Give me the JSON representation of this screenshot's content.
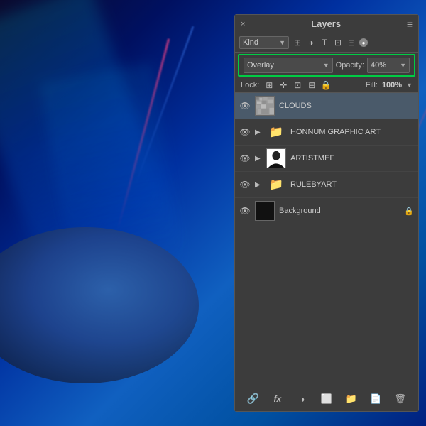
{
  "background": {
    "description": "Space scene with planet and light streaks"
  },
  "panel": {
    "title": "Layers",
    "close_label": "×",
    "menu_icon": "≡",
    "toolbar": {
      "kind_label": "Kind",
      "icons": [
        "checkerboard",
        "circle-half",
        "T",
        "transform",
        "artboard",
        "dot"
      ]
    },
    "blend_row": {
      "blend_mode": "Overlay",
      "opacity_label": "Opacity:",
      "opacity_value": "40%",
      "chevron": "▼"
    },
    "lock_row": {
      "lock_label": "Lock:",
      "icons": [
        "grid",
        "move",
        "transform",
        "artboard",
        "lock"
      ],
      "fill_label": "Fill:",
      "fill_value": "100%"
    },
    "layers": [
      {
        "id": "clouds",
        "visible": true,
        "expand": false,
        "thumb_type": "clouds",
        "name": "CLOUDS",
        "locked": false,
        "selected": true
      },
      {
        "id": "honnum",
        "visible": true,
        "expand": true,
        "thumb_type": "folder",
        "name": "HONNUM GRAPHIC ART",
        "locked": false,
        "selected": false
      },
      {
        "id": "artistmef",
        "visible": true,
        "expand": true,
        "thumb_type": "person",
        "name": "ARTISTMEF",
        "locked": false,
        "selected": false
      },
      {
        "id": "rulebyart",
        "visible": true,
        "expand": true,
        "thumb_type": "folder",
        "name": "RULEBYART",
        "locked": false,
        "selected": false
      },
      {
        "id": "background",
        "visible": true,
        "expand": false,
        "thumb_type": "black",
        "name": "Background",
        "locked": true,
        "selected": false
      }
    ],
    "footer": {
      "icons": [
        "link",
        "fx",
        "new-layer",
        "adjustment",
        "folder",
        "mask",
        "trash"
      ]
    }
  }
}
